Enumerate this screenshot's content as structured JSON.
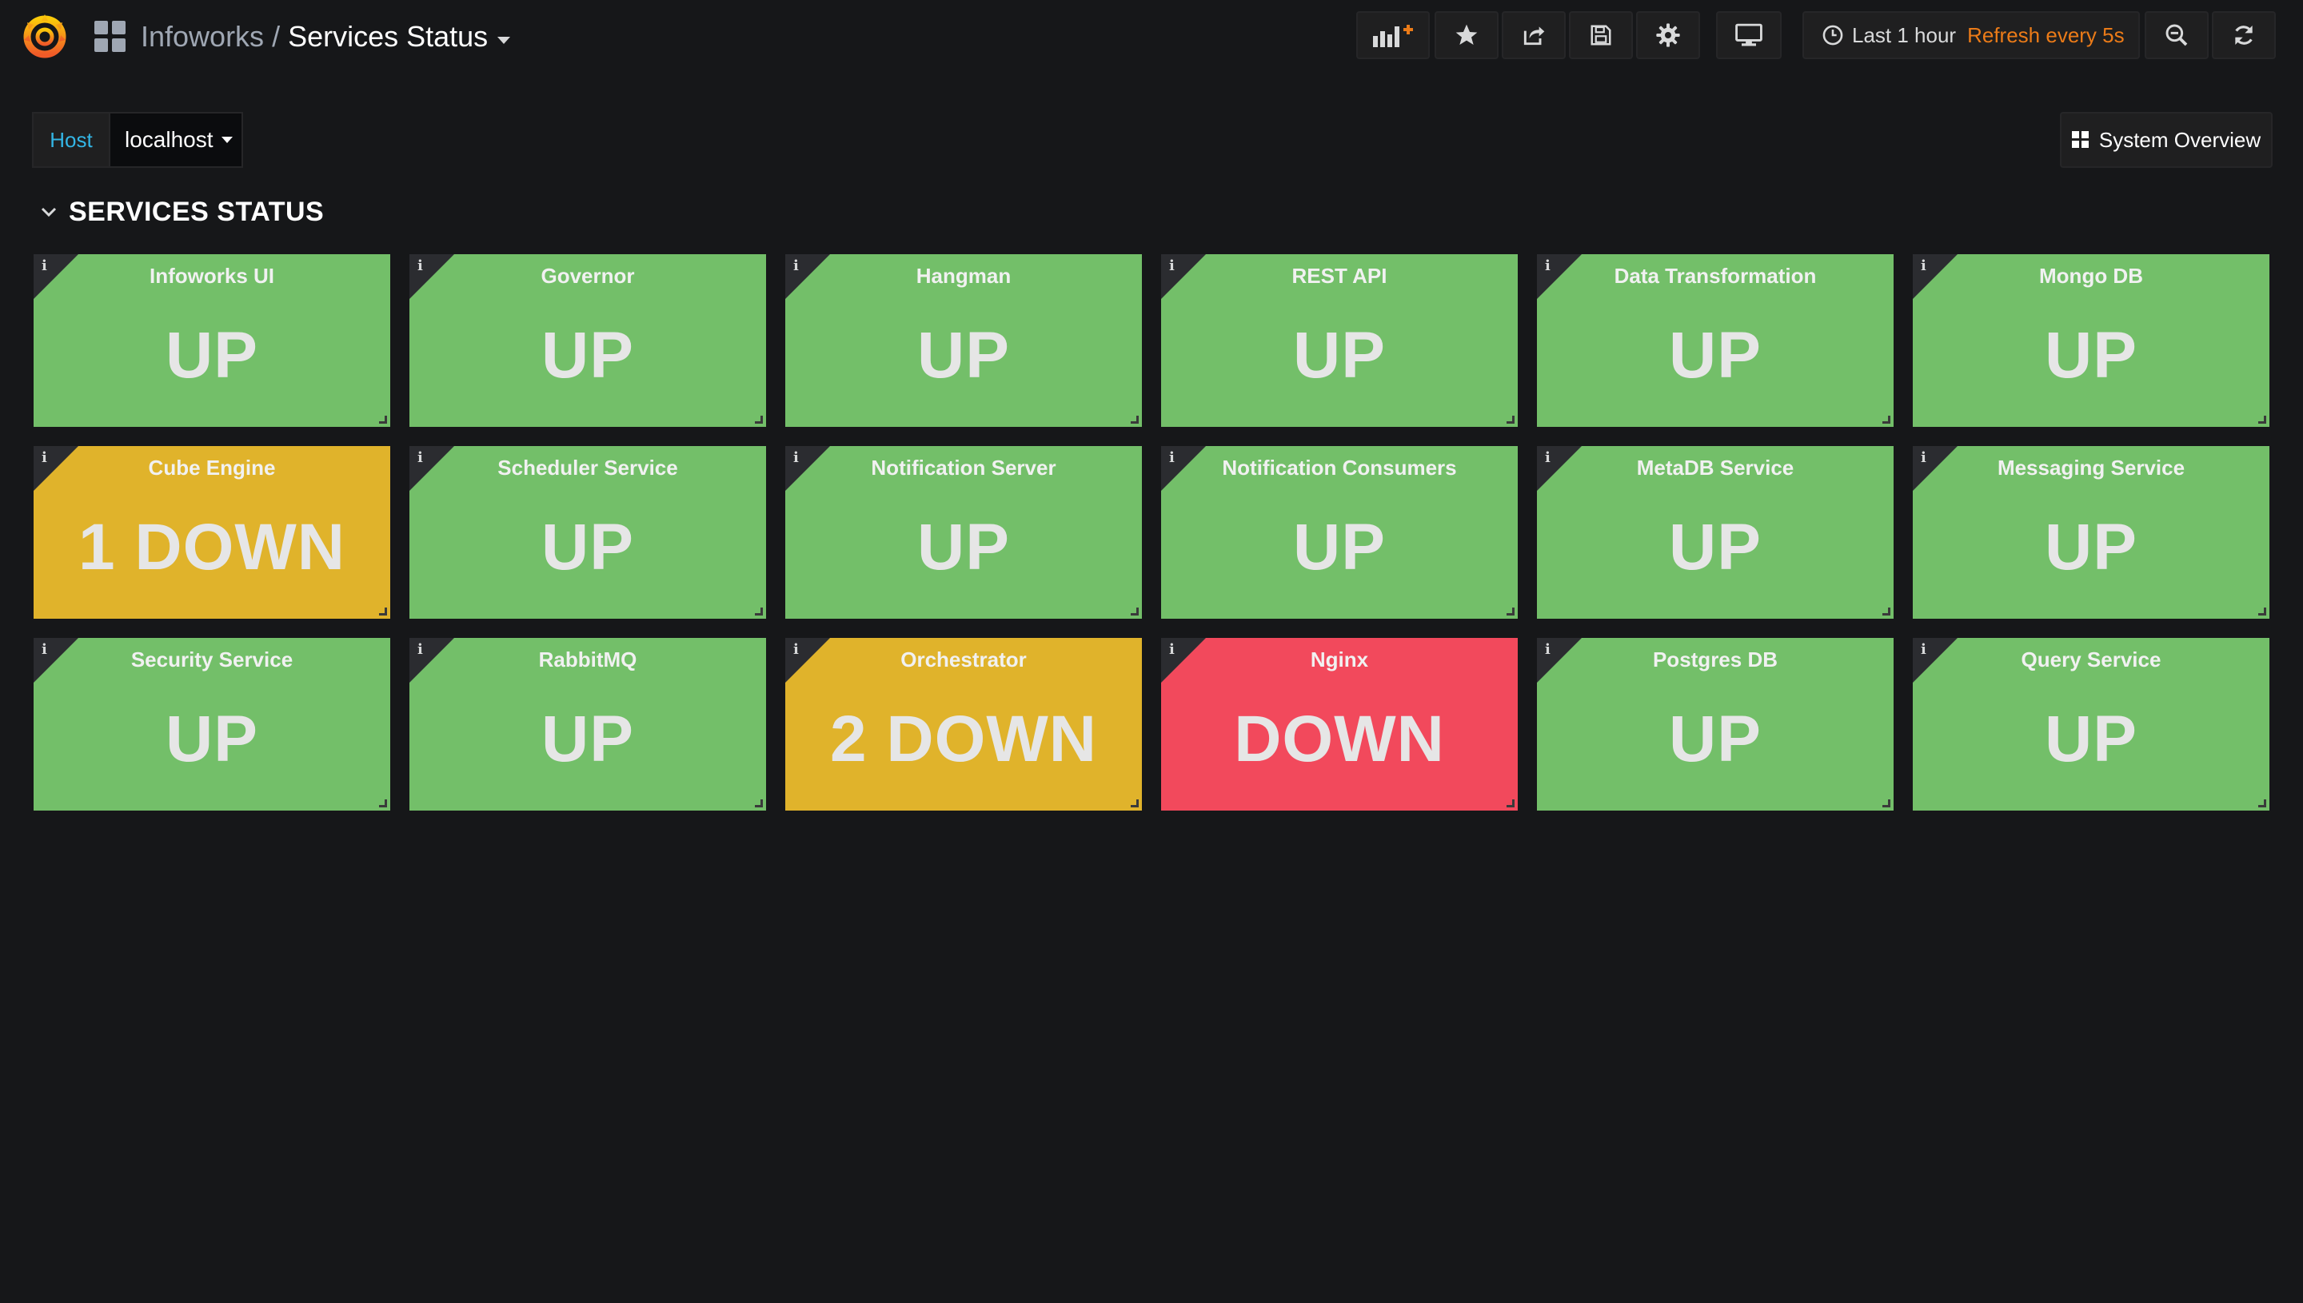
{
  "header": {
    "folder": "Infoworks",
    "separator": "/",
    "title": "Services Status",
    "time_range": "Last 1 hour",
    "refresh": "Refresh every 5s"
  },
  "toolbar": {
    "icons": [
      "add-panel-icon",
      "star-icon",
      "share-icon",
      "save-icon",
      "settings-icon",
      "tv-mode-icon",
      "clock-icon",
      "zoom-out-icon",
      "refresh-icon"
    ]
  },
  "variables": {
    "label": "Host",
    "value": "localhost"
  },
  "links": {
    "system_overview": "System Overview"
  },
  "row": {
    "title": "SERVICES STATUS"
  },
  "colors": {
    "up": "#73bf69",
    "degraded": "#e0b32b",
    "down": "#f2495c",
    "accent_blue": "#33b5e5",
    "accent_orange": "#eb7b18"
  },
  "panels": [
    {
      "title": "Infoworks UI",
      "value": "UP",
      "status": "up"
    },
    {
      "title": "Governor",
      "value": "UP",
      "status": "up"
    },
    {
      "title": "Hangman",
      "value": "UP",
      "status": "up"
    },
    {
      "title": "REST API",
      "value": "UP",
      "status": "up"
    },
    {
      "title": "Data Transformation",
      "value": "UP",
      "status": "up"
    },
    {
      "title": "Mongo DB",
      "value": "UP",
      "status": "up"
    },
    {
      "title": "Cube Engine",
      "value": "1 DOWN",
      "status": "degraded"
    },
    {
      "title": "Scheduler Service",
      "value": "UP",
      "status": "up"
    },
    {
      "title": "Notification Server",
      "value": "UP",
      "status": "up"
    },
    {
      "title": "Notification Consumers",
      "value": "UP",
      "status": "up"
    },
    {
      "title": "MetaDB Service",
      "value": "UP",
      "status": "up"
    },
    {
      "title": "Messaging Service",
      "value": "UP",
      "status": "up"
    },
    {
      "title": "Security Service",
      "value": "UP",
      "status": "up"
    },
    {
      "title": "RabbitMQ",
      "value": "UP",
      "status": "up"
    },
    {
      "title": "Orchestrator",
      "value": "2 DOWN",
      "status": "degraded"
    },
    {
      "title": "Nginx",
      "value": "DOWN",
      "status": "down"
    },
    {
      "title": "Postgres DB",
      "value": "UP",
      "status": "up"
    },
    {
      "title": "Query Service",
      "value": "UP",
      "status": "up"
    }
  ]
}
